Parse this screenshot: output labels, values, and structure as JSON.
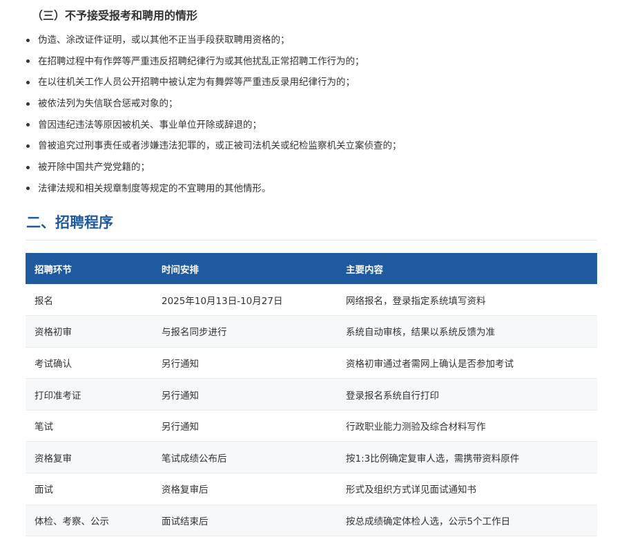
{
  "section3": {
    "heading": "（三）不予接受报考和聘用的情形",
    "items": [
      "伪造、涂改证件证明，或以其他不正当手段获取聘用资格的；",
      "在招聘过程中有作弊等严重违反招聘纪律行为或其他扰乱正常招聘工作行为的；",
      "在以往机关工作人员公开招聘中被认定为有舞弊等严重违反录用纪律行为的；",
      "被依法列为失信联合惩戒对象的；",
      "曾因违纪违法等原因被机关、事业单位开除或辞退的；",
      "曾被追究过刑事责任或者涉嫌违法犯罪的，或正被司法机关或纪检监察机关立案侦查的；",
      "被开除中国共产党党籍的；",
      "法律法规和相关规章制度等规定的不宜聘用的其他情形。"
    ]
  },
  "section2": {
    "title": "二、招聘程序"
  },
  "table": {
    "headers": [
      "招聘环节",
      "时间安排",
      "主要内容"
    ],
    "rows": [
      [
        "报名",
        "2025年10月13日-10月27日",
        "网络报名，登录指定系统填写资料"
      ],
      [
        "资格初审",
        "与报名同步进行",
        "系统自动审核，结果以系统反馈为准"
      ],
      [
        "考试确认",
        "另行通知",
        "资格初审通过者需网上确认是否参加考试"
      ],
      [
        "打印准考证",
        "另行通知",
        "登录报名系统自行打印"
      ],
      [
        "笔试",
        "另行通知",
        "行政职业能力测验及综合材料写作"
      ],
      [
        "资格复审",
        "笔试成绩公布后",
        "按1:3比例确定复审人选，需携带资料原件"
      ],
      [
        "面试",
        "资格复审后",
        "形式及组织方式详见面试通知书"
      ],
      [
        "体检、考察、公示",
        "面试结束后",
        "按总成绩确定体检人选，公示5个工作日"
      ]
    ]
  },
  "colors": {
    "accent": "#1f5aa0",
    "text": "#333333",
    "row_alt": "#f7f8fa",
    "rule": "#e5e7eb"
  }
}
